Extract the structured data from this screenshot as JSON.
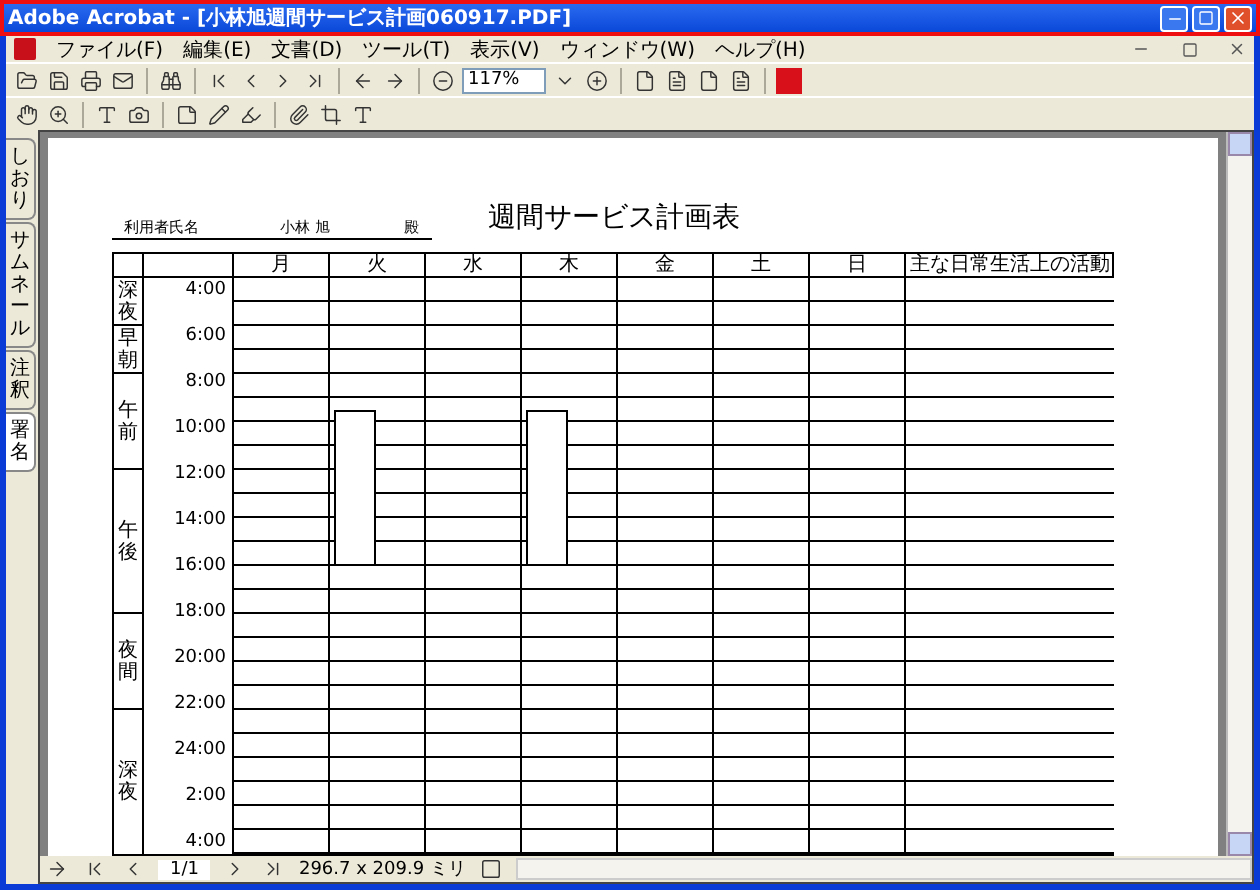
{
  "window": {
    "title": "Adobe Acrobat - [小林旭週間サービス計画060917.PDF]"
  },
  "menu": [
    "ファイル(F)",
    "編集(E)",
    "文書(D)",
    "ツール(T)",
    "表示(V)",
    "ウィンドウ(W)",
    "ヘルプ(H)"
  ],
  "toolbar": {
    "zoom_value": "117%"
  },
  "nav_tabs": [
    {
      "label": "しおり",
      "selected": false
    },
    {
      "label": "サムネール",
      "selected": false
    },
    {
      "label": "注釈",
      "selected": false
    },
    {
      "label": "署名",
      "selected": true
    }
  ],
  "document": {
    "recipient_label": "利用者氏名",
    "recipient_name": "小林 旭",
    "honorific": "殿",
    "title": "週間サービス計画表",
    "days": [
      {
        "label": "月",
        "service": false
      },
      {
        "label": "火",
        "service": true
      },
      {
        "label": "水",
        "service": false
      },
      {
        "label": "木",
        "service": true
      },
      {
        "label": "金",
        "service": false
      },
      {
        "label": "土",
        "service": false
      },
      {
        "label": "日",
        "service": false
      }
    ],
    "activity_header": "主な日常生活上の活動",
    "periods": [
      "深夜",
      "早朝",
      "午前",
      "午後",
      "夜間",
      "深夜"
    ],
    "times": [
      "4:00",
      "6:00",
      "8:00",
      "10:00",
      "12:00",
      "14:00",
      "16:00",
      "18:00",
      "20:00",
      "22:00",
      "24:00",
      "2:00",
      "4:00"
    ]
  },
  "status_bar": {
    "page": "1/1",
    "page_size": "296.7 x 209.9 ミリ"
  }
}
